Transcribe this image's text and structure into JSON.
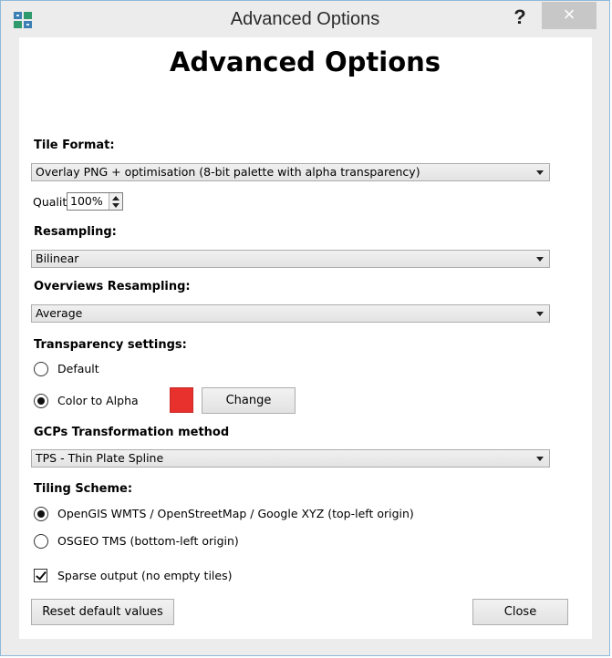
{
  "window": {
    "title": "Advanced Options",
    "help_label": "?",
    "close_label": "×"
  },
  "heading": "Advanced Options",
  "tile_format": {
    "label": "Tile Format:",
    "value": "Overlay PNG + optimisation (8-bit palette with alpha transparency)"
  },
  "quality": {
    "label": "Quality:",
    "value": "100%"
  },
  "resampling": {
    "label": "Resampling:",
    "value": "Bilinear"
  },
  "overviews_resampling": {
    "label": "Overviews Resampling:",
    "value": "Average"
  },
  "transparency": {
    "label": "Transparency settings:",
    "options": [
      "Default",
      "Color to Alpha"
    ],
    "selected": "Color to Alpha",
    "color": "#e8302d",
    "change_label": "Change"
  },
  "gcps": {
    "label": "GCPs Transformation method",
    "value": "TPS - Thin Plate Spline"
  },
  "tiling_scheme": {
    "label": "Tiling Scheme:",
    "options": [
      "OpenGIS WMTS / OpenStreetMap / Google XYZ (top-left origin)",
      "OSGEO TMS (bottom-left origin)"
    ],
    "selected": "OpenGIS WMTS / OpenStreetMap / Google XYZ (top-left origin)"
  },
  "sparse_output": {
    "label": "Sparse output (no empty tiles)",
    "checked": true
  },
  "footer": {
    "reset_label": "Reset default values",
    "close_label": "Close"
  }
}
